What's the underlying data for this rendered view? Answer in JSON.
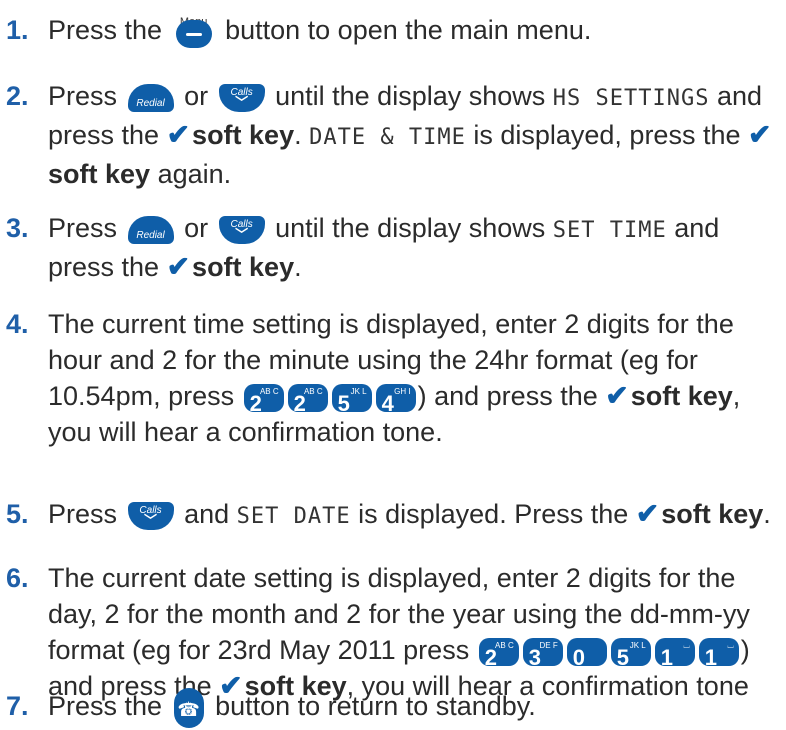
{
  "icons": {
    "menu_caption": "Menu",
    "redial_label": "Redial",
    "calls_label": "Calls",
    "tick_glyph": "✔",
    "phone_glyph": "☎",
    "power_glyph": "⏻",
    "accent_color": "#0f5ea8",
    "number_color": "#1f5fa8"
  },
  "steps": [
    {
      "num": "1.",
      "a": "Press the",
      "b": "button to open the main menu."
    },
    {
      "num": "2.",
      "a": "Press",
      "or": "or",
      "b": "until the display shows",
      "mono1": "HS SETTINGS",
      "c": "and press the",
      "sk": "soft key",
      "d": ".",
      "mono2": "DATE & TIME",
      "e": "is displayed, press the",
      "sk2": "soft key",
      "f": "again."
    },
    {
      "num": "3.",
      "a": "Press",
      "or": "or",
      "b": "until the display shows",
      "mono1": "SET TIME",
      "c": "and press the",
      "sk": "soft key",
      "d": "."
    },
    {
      "num": "4.",
      "a": "The current time setting is displayed, enter 2 digits for the hour and 2 for the minute using the 24hr format (eg for 10.54pm, press",
      "b": ") and press the",
      "sk": "soft key",
      "c": ", you will hear a confirmation tone."
    },
    {
      "num": "5.",
      "a": "Press",
      "b": "and",
      "mono1": "SET DATE",
      "c": "is displayed. Press the",
      "sk": "soft key",
      "d": "."
    },
    {
      "num": "6.",
      "a": "The current date setting is displayed, enter 2 digits for the day, 2 for the month and 2 for the year using the dd-mm-yy format (eg for 23rd May 2011 press",
      "b": ") and press the",
      "sk": "soft key",
      "c": ", you will hear a confirmation tone"
    },
    {
      "num": "7.",
      "a": "Press the",
      "b": "button to return to standby."
    }
  ],
  "keys_time": [
    {
      "d": "2",
      "s": "AB C"
    },
    {
      "d": "2",
      "s": "AB C"
    },
    {
      "d": "5",
      "s": "JK L"
    },
    {
      "d": "4",
      "s": "GH I"
    }
  ],
  "keys_date": [
    {
      "d": "2",
      "s": "AB C"
    },
    {
      "d": "3",
      "s": "DE F"
    },
    {
      "d": "0",
      "s": ""
    },
    {
      "d": "5",
      "s": "JK L"
    },
    {
      "d": "1",
      "s": "⌴"
    },
    {
      "d": "1",
      "s": "⌴"
    }
  ]
}
